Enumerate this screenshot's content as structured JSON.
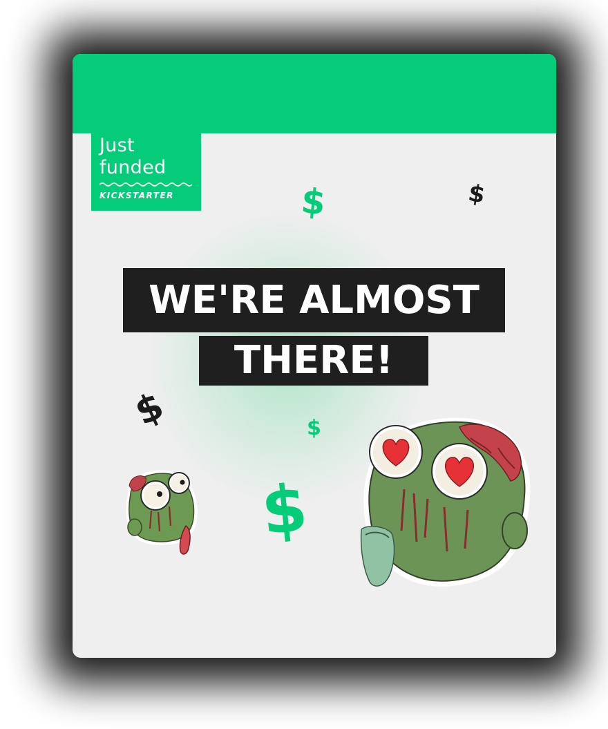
{
  "badge": {
    "line1": "Just",
    "line2": "funded",
    "platform": "KICKSTARTER"
  },
  "headline": {
    "line1": "WE'RE ALMOST",
    "line2": "THERE!"
  },
  "dollar_symbol": "$",
  "colors": {
    "accent_green": "#05cc79",
    "card_background": "#efefef",
    "headline_background": "#1f1f1f",
    "headline_text": "#ffffff",
    "dark_dollar": "#1b1b1b"
  },
  "illustrations": [
    "small-zombie-head-sticker",
    "large-zombie-head-heart-eyes-sticker"
  ]
}
